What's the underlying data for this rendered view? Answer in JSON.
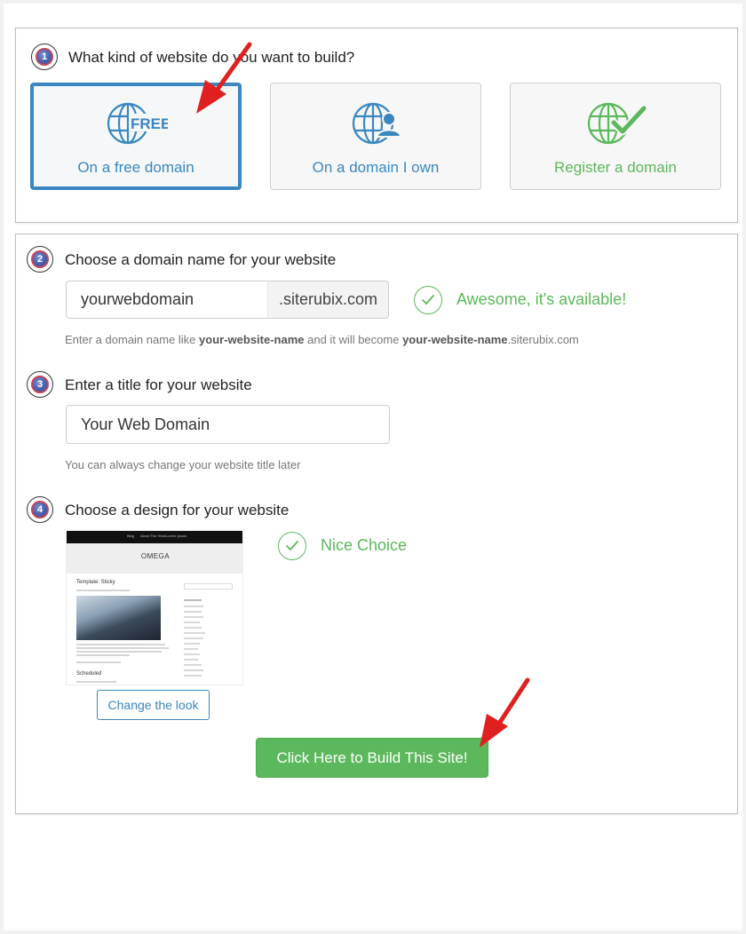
{
  "steps": [
    {
      "number": "1",
      "title": "What kind of website do you want to build?"
    },
    {
      "number": "2",
      "title": "Choose a domain name for your website"
    },
    {
      "number": "3",
      "title": "Enter a title for your website"
    },
    {
      "number": "4",
      "title": "Choose a design for your website"
    }
  ],
  "options": [
    {
      "label": "On a free domain",
      "icon": "globe-free-icon",
      "icon_text": "FREE",
      "color": "#3b87c0",
      "selected": true
    },
    {
      "label": "On a domain I own",
      "icon": "globe-user-icon",
      "color": "#3b87c0",
      "selected": false
    },
    {
      "label": "Register a domain",
      "icon": "globe-check-icon",
      "color": "#5cb85c",
      "selected": false
    }
  ],
  "domain": {
    "value": "yourwebdomain",
    "suffix": ".siterubix.com",
    "status": "Awesome, it's available!",
    "help_prefix": "Enter a domain name like ",
    "help_example": "your-website-name",
    "help_middle": " and it will become ",
    "help_result": "your-website-name",
    "help_suffix": ".siterubix.com"
  },
  "site_title": {
    "value": "Your Web Domain",
    "help": "You can always change your website title later"
  },
  "design": {
    "status": "Nice Choice",
    "change_label": "Change the look",
    "theme_preview": {
      "nav_items": [
        "Blog",
        "About The Tests",
        "Lorem Ipsum"
      ],
      "site_name": "OMEGA",
      "post_title": "Template: Sticky",
      "section_title": "Scheduled"
    }
  },
  "build_button": "Click Here to Build This Site!",
  "colors": {
    "accent_blue": "#3b87c0",
    "success_green": "#5cb85c",
    "arrow_red": "#e02020"
  }
}
